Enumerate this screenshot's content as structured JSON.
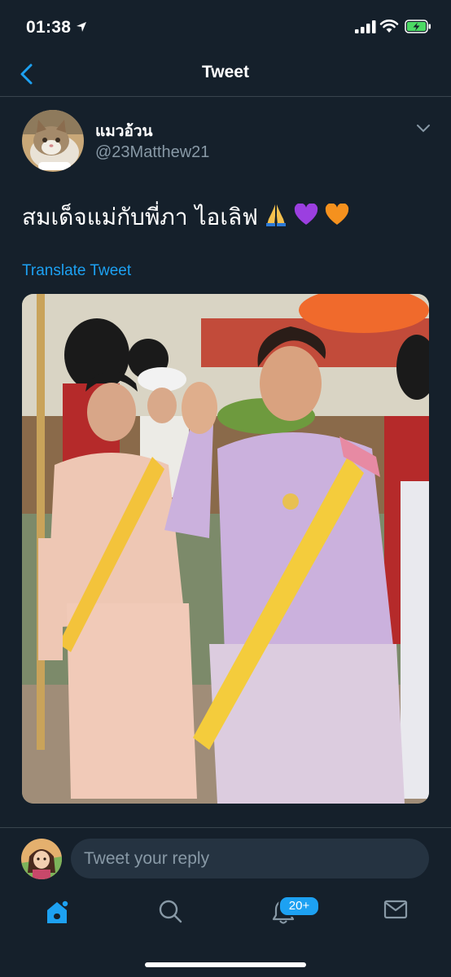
{
  "status_bar": {
    "time": "01:38"
  },
  "nav": {
    "title": "Tweet",
    "back_icon": "chevron-left-icon"
  },
  "tweet": {
    "display_name": "แมวอ้วน",
    "handle": "@23Matthew21",
    "text": "สมเด็จแม่กับพี่ภา ไอเลิฟ",
    "emojis": [
      "🙏",
      "💜",
      "🧡"
    ],
    "translate_label": "Translate Tweet",
    "more_icon": "chevron-down-icon"
  },
  "reply": {
    "placeholder": "Tweet your reply"
  },
  "tabbar": {
    "items": [
      {
        "icon": "home-icon",
        "active": true
      },
      {
        "icon": "search-icon",
        "active": false
      },
      {
        "icon": "bell-icon",
        "active": false
      },
      {
        "icon": "mail-icon",
        "active": false
      }
    ],
    "notification_badge": "20+"
  },
  "colors": {
    "background": "#15202b",
    "accent": "#1da1f2",
    "secondary_text": "#8899a6",
    "divider": "#38444d"
  }
}
